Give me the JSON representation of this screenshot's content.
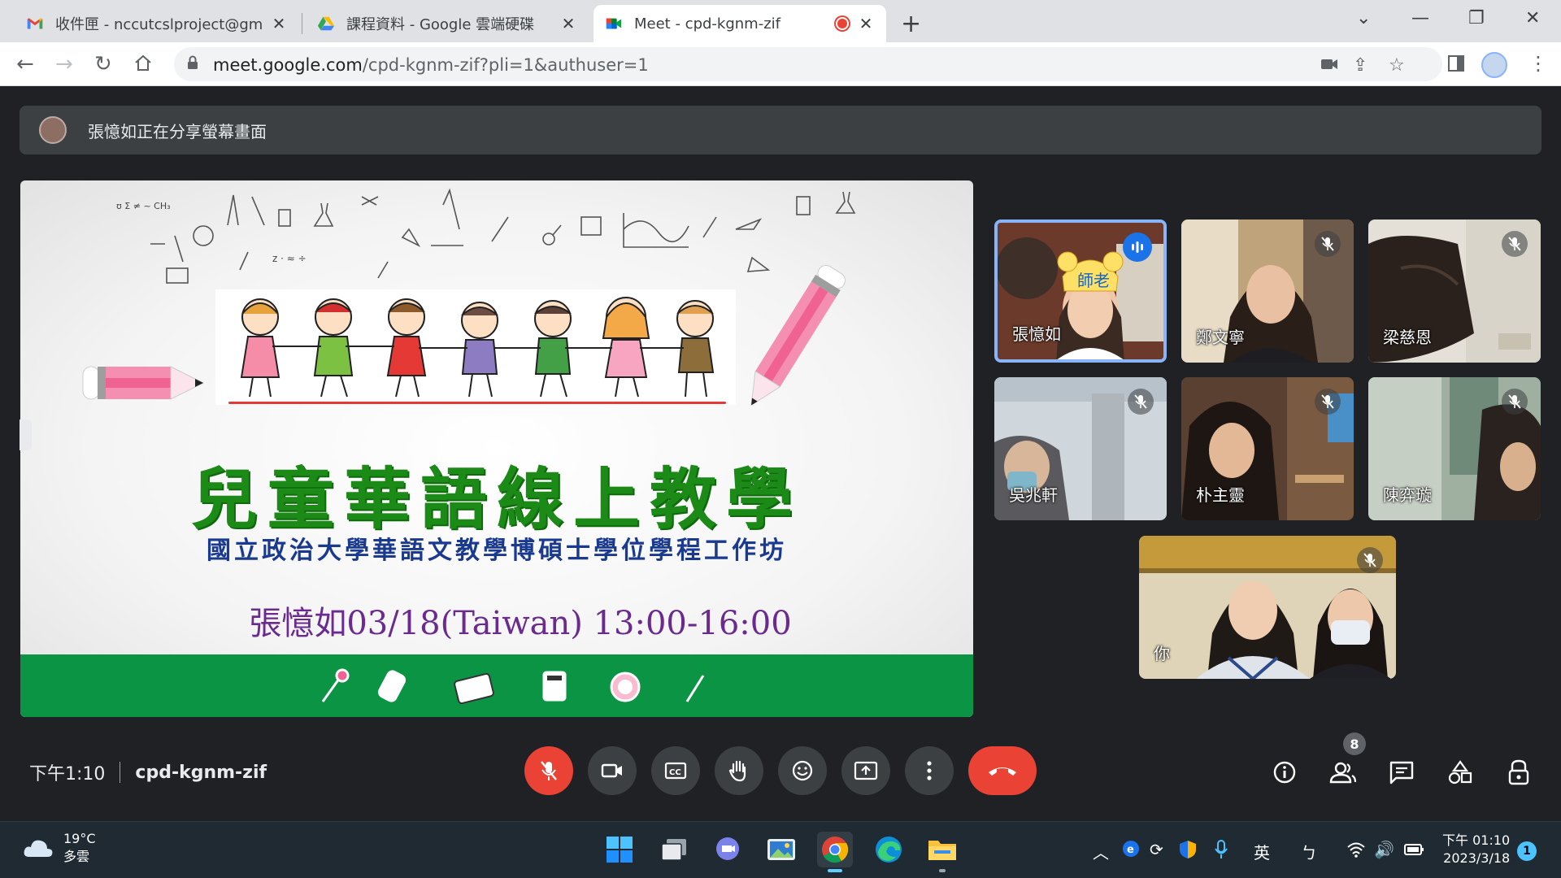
{
  "browser": {
    "tabs": [
      {
        "title": "收件匣 - nccutcslproject@gmail",
        "icon": "gmail-icon"
      },
      {
        "title": "課程資料 - Google 雲端硬碟",
        "icon": "drive-icon"
      },
      {
        "title": "Meet - cpd-kgnm-zif",
        "icon": "meet-icon",
        "active": true,
        "recording": true
      }
    ],
    "url_host": "meet.google.com",
    "url_path": "/cpd-kgnm-zif?pli=1&authuser=1"
  },
  "meet": {
    "share_banner": "張憶如正在分享螢幕畫面",
    "slide": {
      "title": "兒童華語線上教學",
      "subtitle": "國立政治大學華語文教學博碩士學位學程工作坊",
      "date_line": "張憶如03/18(Taiwan) 13:00-16:00"
    },
    "participants": [
      {
        "name": "張憶如",
        "speaking": true,
        "muted": false
      },
      {
        "name": "鄭文寧",
        "speaking": false,
        "muted": true
      },
      {
        "name": "梁慈恩",
        "speaking": false,
        "muted": true
      },
      {
        "name": "吳兆軒",
        "speaking": false,
        "muted": true
      },
      {
        "name": "朴主靈",
        "speaking": false,
        "muted": true
      },
      {
        "name": "陳弈璇",
        "speaking": false,
        "muted": true
      },
      {
        "name": "你",
        "speaking": false,
        "muted": true
      }
    ],
    "time": "下午1:10",
    "meeting_code": "cpd-kgnm-zif",
    "people_count": "8"
  },
  "taskbar": {
    "weather_temp": "19°C",
    "weather_desc": "多雲",
    "ime_lang": "英",
    "ime_mode": "ㄅ",
    "clock_time": "下午 01:10",
    "clock_date": "2023/3/18",
    "notification_count": "1"
  },
  "colors": {
    "meet_bg": "#202124",
    "surface": "#3c4043",
    "danger": "#ea4335",
    "speaking_border": "#8ab4f8",
    "slide_green": "#0b9444",
    "slide_title": "#1b8a17"
  }
}
